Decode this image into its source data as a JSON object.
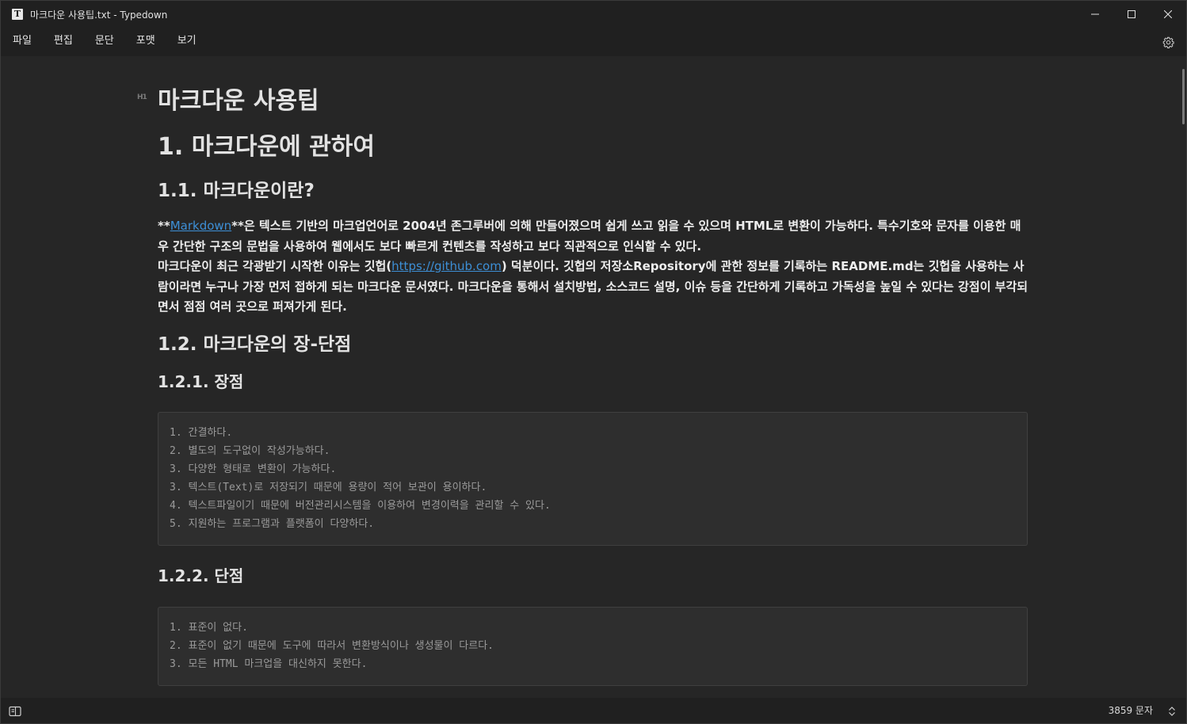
{
  "window": {
    "title": "마크다운 사용팁.txt - Typedown",
    "app_icon_letter": "T"
  },
  "menu": {
    "items": [
      "파일",
      "편집",
      "문단",
      "포맷",
      "보기"
    ]
  },
  "document": {
    "h1_marker": "H1",
    "title": "마크다운 사용팁",
    "section1": "1. 마크다운에 관하여",
    "section1_1": "1.1. 마크다운이란?",
    "para1": {
      "prefix": "**",
      "link_text": "Markdown",
      "rest": "**은 텍스트 기반의 마크업언어로 2004년 존그루버에 의해 만들어졌으며 쉽게 쓰고 읽을 수 있으며 HTML로 변환이 가능하다. 특수기호와 문자를 이용한 매우 간단한 구조의 문법을 사용하여 웹에서도 보다 빠르게 컨텐츠를 작성하고 보다 직관적으로 인식할 수 있다."
    },
    "para2": {
      "prefix": "마크다운이 최근 각광받기 시작한 이유는 깃헙(",
      "link_text": "https://github.com",
      "rest": ") 덕분이다. 깃헙의 저장소Repository에 관한 정보를 기록하는 README.md는 깃헙을 사용하는 사람이라면 누구나 가장 먼저 접하게 되는 마크다운 문서였다. 마크다운을 통해서 설치방법, 소스코드 설명, 이슈 등을 간단하게 기록하고 가독성을 높일 수 있다는 강점이 부각되면서 점점 여러 곳으로 퍼져가게 된다."
    },
    "section1_2": "1.2. 마크다운의 장-단점",
    "section1_2_1": "1.2.1. 장점",
    "pros": [
      "1. 간결하다.",
      "2. 별도의 도구없이 작성가능하다.",
      "3. 다양한 형태로 변환이 가능하다.",
      "3. 텍스트(Text)로 저장되기 때문에 용량이 적어 보관이 용이하다.",
      "4. 텍스트파일이기 때문에 버전관리시스템을 이용하여 변경이력을 관리할 수 있다.",
      "5. 지원하는 프로그램과 플랫폼이 다양하다."
    ],
    "section1_2_2": "1.2.2. 단점",
    "cons": [
      "1. 표준이 없다.",
      "2. 표준이 없기 때문에 도구에 따라서 변환방식이나 생성물이 다르다.",
      "3. 모든 HTML 마크업을 대신하지 못한다."
    ]
  },
  "status": {
    "char_count": "3859 문자"
  },
  "icons": {
    "minimize": "minimize-icon",
    "maximize": "maximize-icon",
    "close": "close-icon",
    "settings": "gear-icon",
    "sidebar": "sidebar-toggle-icon",
    "updown": "chevron-updown-icon"
  },
  "colors": {
    "background": "#262626",
    "chrome": "#202020",
    "link": "#3d8fd6",
    "code_bg": "#2e2e2e"
  }
}
